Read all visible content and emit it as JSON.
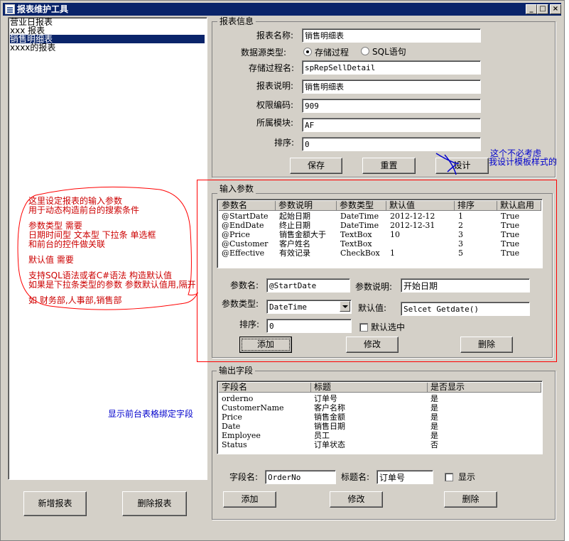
{
  "window": {
    "title": "报表维护工具",
    "btn_min": "_",
    "btn_max": "□",
    "btn_close": "×"
  },
  "report_list": [
    "营业日报表",
    "xxx 报表",
    "销售明细表",
    "xxxx的报表"
  ],
  "left_buttons": {
    "add": "新增报表",
    "delete": "删除报表"
  },
  "report_info": {
    "title": "报表信息",
    "name_label": "报表名称:",
    "name_value": "销售明细表",
    "source_label": "数据源类型:",
    "radio_proc": "存储过程",
    "radio_sql": "SQL语句",
    "proc_label": "存储过程名:",
    "proc_value": "spRepSellDetail",
    "desc_label": "报表说明:",
    "desc_value": "销售明细表",
    "perm_label": "权限编码:",
    "perm_value": "909",
    "module_label": "所属模块:",
    "module_value": "AF",
    "sort_label": "排序:",
    "sort_value": "0",
    "btn_save": "保存",
    "btn_reset": "重置",
    "btn_design": "设计"
  },
  "input_params": {
    "title": "输入参数",
    "columns": [
      "参数名",
      "参数说明",
      "参数类型",
      "默认值",
      "排序",
      "默认启用"
    ],
    "rows": [
      [
        "@StartDate",
        "起始日期",
        "DateTime",
        "2012-12-12",
        "1",
        "True"
      ],
      [
        "@EndDate",
        "终止日期",
        "DateTime",
        "2012-12-31",
        "2",
        "True"
      ],
      [
        "@Price",
        "销售金额大于",
        "TextBox",
        "10",
        "3",
        "True"
      ],
      [
        "@Customer",
        "客户姓名",
        "TextBox",
        "",
        "3",
        "True"
      ],
      [
        "@Effective",
        "有效记录",
        "CheckBox",
        "1",
        "5",
        "True"
      ]
    ],
    "pname_label": "参数名:",
    "pname_value": "@StartDate",
    "pdesc_label": "参数说明:",
    "pdesc_value": "开始日期",
    "ptype_label": "参数类型:",
    "ptype_value": "DateTime",
    "pdefault_label": "默认值:",
    "pdefault_value": "Selcet Getdate()",
    "psort_label": "排序:",
    "psort_value": "0",
    "pcheck_label": "默认选中",
    "btn_add": "添加",
    "btn_edit": "修改",
    "btn_delete": "删除"
  },
  "output_fields": {
    "title": "输出字段",
    "columns": [
      "字段名",
      "标题",
      "是否显示"
    ],
    "rows": [
      [
        "orderno",
        "订单号",
        "是"
      ],
      [
        "CustomerName",
        "客户名称",
        "是"
      ],
      [
        "Price",
        "销售金额",
        "是"
      ],
      [
        "Date",
        "销售日期",
        "是"
      ],
      [
        "Employee",
        "员工",
        "是"
      ],
      [
        "Status",
        "订单状态",
        "否"
      ]
    ],
    "fname_label": "字段名:",
    "fname_value": "OrderNo",
    "ftitle_label": "标题名:",
    "ftitle_value": "订单号",
    "fshow_label": "显示",
    "btn_add": "添加",
    "btn_edit": "修改",
    "btn_delete": "删除"
  },
  "annotations": {
    "design_note": [
      "这个不必考虑",
      "我设计模板样式的"
    ],
    "params_note": [
      "这里设定报表的输入参数",
      "用于动态构造前台的搜索条件",
      "",
      "参数类型  需要",
      "   日期时间型  文本型  下拉条  单选框",
      "和前台的控件做关联",
      "",
      "默认值  需要",
      "",
      " 支持SQL语法或者C#语法  构造默认值",
      "如果是下拉条类型的参数  参数默认值用,隔开",
      "",
      "如  财务部,人事部,销售部"
    ],
    "output_note": "显示前台表格绑定字段"
  },
  "colors": {
    "titlebar": "#0a246a",
    "form_bg": "#d4d0c8",
    "annotation_red": "#cc0000",
    "annotation_blue": "#0000cc",
    "highlight_border": "#ff0000"
  }
}
